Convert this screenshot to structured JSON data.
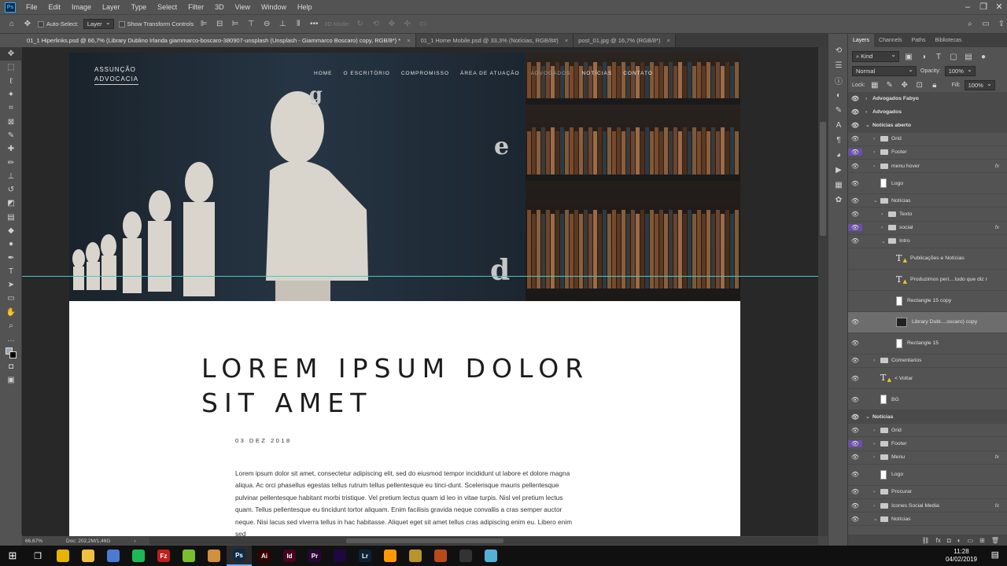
{
  "menu": {
    "items": [
      "File",
      "Edit",
      "Image",
      "Layer",
      "Type",
      "Select",
      "Filter",
      "3D",
      "View",
      "Window",
      "Help"
    ],
    "logo": "Ps"
  },
  "options": {
    "auto_select": "Auto-Select:",
    "layer_select": "Layer",
    "show_transform": "Show Transform Controls",
    "mode3d": "3D Mode:"
  },
  "tabs": [
    {
      "label": "01_1 Hiperlinks.psd @ 66,7% (Library Dublino Irlanda giammarco-boscaro-380907-unsplash (Unsplash - Giammarco Boscaro) copy, RGB/8*) *"
    },
    {
      "label": "01_1 Home Mobile.psd @ 33,3% (Notícias, RGB/8#)"
    },
    {
      "label": "post_01.jpg @ 16,7% (RGB/8*)"
    }
  ],
  "design": {
    "brand_line1": "ASSUNÇÃO",
    "brand_line2": "ADVOCACIA",
    "nav": [
      "HOME",
      "O ESCRITÓRIO",
      "COMPROMISSO",
      "ÁREA DE ATUAÇÃO",
      "ADVOGADOS",
      "NOTÍCIAS",
      "CONTATO"
    ],
    "hero_letters": [
      "g",
      "e",
      "d"
    ],
    "headline_1": "LOREM IPSUM DOLOR",
    "headline_2": "SIT AMET",
    "date": "03 DEZ 2018",
    "body": "Lorem ipsum dolor sit amet, consectetur adipiscing elit, sed do eiusmod tempor incididunt ut labore et dolore magna aliqua. Ac orci phasellus egestas tellus rutrum tellus pellentesque eu tinci-dunt. Scelerisque mauris pellentesque pulvinar pellentesque habitant morbi tristique. Vel pretium lectus quam id leo in vitae turpis. Nisl vel pretium lectus quam. Tellus pellentesque eu tincidunt tortor aliquam. Enim facilisis gravida neque convallis a cras semper auctor neque. Nisi lacus sed viverra tellus in hac habitasse. Aliquet eget sit amet tellus cras adipiscing enim eu. Libero enim sed"
  },
  "status": {
    "zoom": "66,67%",
    "doc": "Doc: 202,2M/1,46G"
  },
  "panel": {
    "tabs": [
      "Layers",
      "Channels",
      "Paths",
      "Bibliotecas"
    ],
    "kind": "Kind",
    "blend": "Normal",
    "opacity_label": "Opacity:",
    "opacity": "100%",
    "lock_label": "Lock:",
    "fill_label": "Fill:",
    "fill": "100%",
    "layers": [
      {
        "name": "Advogados Fabyo",
        "type": "group-head",
        "indent": 0
      },
      {
        "name": "Advogados",
        "type": "group-head",
        "indent": 0
      },
      {
        "name": "Notícias aberto",
        "type": "group-head-open",
        "indent": 0
      },
      {
        "name": "Grid",
        "type": "folder",
        "indent": 1
      },
      {
        "name": "Footer",
        "type": "folder",
        "indent": 1,
        "purple": true
      },
      {
        "name": "menu hover",
        "type": "folder",
        "indent": 1,
        "fx": true
      },
      {
        "name": "Logo",
        "type": "smart",
        "indent": 1
      },
      {
        "name": "Notícias",
        "type": "folder-open",
        "indent": 1
      },
      {
        "name": "Texto",
        "type": "folder",
        "indent": 2
      },
      {
        "name": "social",
        "type": "folder",
        "indent": 2,
        "purple": true,
        "fx": true
      },
      {
        "name": "Intro",
        "type": "folder-open",
        "indent": 2
      },
      {
        "name": "Publicações e Notícias",
        "type": "text",
        "indent": 3,
        "hidden": true
      },
      {
        "name": "Produzimos peri....tudo que diz r",
        "type": "text",
        "indent": 3,
        "hidden": true
      },
      {
        "name": "Rectangle 15 copy",
        "type": "shape",
        "indent": 3,
        "hidden": true
      },
      {
        "name": "Library Dubl....oscaro) copy",
        "type": "image",
        "indent": 3,
        "selected": true
      },
      {
        "name": "Rectangle 15",
        "type": "shape",
        "indent": 3
      },
      {
        "name": "Comentarios",
        "type": "folder",
        "indent": 1
      },
      {
        "name": "< Voltar",
        "type": "text",
        "indent": 1
      },
      {
        "name": "BG",
        "type": "shape",
        "indent": 1
      },
      {
        "name": "Notícias",
        "type": "group-head-open",
        "indent": 0
      },
      {
        "name": "Grid",
        "type": "folder",
        "indent": 1
      },
      {
        "name": "Footer",
        "type": "folder",
        "indent": 1,
        "purple": true
      },
      {
        "name": "Menu",
        "type": "folder",
        "indent": 1,
        "fx": true
      },
      {
        "name": "Logo",
        "type": "smart",
        "indent": 1
      },
      {
        "name": "Procurar",
        "type": "folder",
        "indent": 1
      },
      {
        "name": "Icones Social Media",
        "type": "folder",
        "indent": 1,
        "fx": true
      },
      {
        "name": "Notícias",
        "type": "folder-open",
        "indent": 1
      }
    ]
  },
  "taskbar": {
    "apps": [
      {
        "name": "chrome",
        "label": "",
        "color": "#e6b400"
      },
      {
        "name": "explorer",
        "label": "",
        "color": "#f0c040"
      },
      {
        "name": "app-circle",
        "label": "",
        "color": "#4a7bd0"
      },
      {
        "name": "spotify",
        "label": "",
        "color": "#1db954"
      },
      {
        "name": "filezilla",
        "label": "Fz",
        "color": "#bf1e1e"
      },
      {
        "name": "app-green",
        "label": "",
        "color": "#7bbd2f"
      },
      {
        "name": "app-game",
        "label": "",
        "color": "#d09040"
      },
      {
        "name": "photoshop",
        "label": "Ps",
        "color": "#0f2a47",
        "active": true
      },
      {
        "name": "illustrator",
        "label": "Ai",
        "color": "#330000"
      },
      {
        "name": "indesign",
        "label": "Id",
        "color": "#49021f"
      },
      {
        "name": "premiere",
        "label": "Pr",
        "color": "#2a0634"
      },
      {
        "name": "after-effects",
        "label": "",
        "color": "#1f0740"
      },
      {
        "name": "lightroom",
        "label": "Lr",
        "color": "#0c2236"
      },
      {
        "name": "sublime",
        "label": "",
        "color": "#ff9800"
      },
      {
        "name": "app-ring",
        "label": "",
        "color": "#b8952b"
      },
      {
        "name": "app-web",
        "label": "",
        "color": "#b84a1a"
      },
      {
        "name": "app-square",
        "label": "",
        "color": "#333"
      },
      {
        "name": "app-folder",
        "label": "",
        "color": "#55b0d8"
      }
    ],
    "time": "11:28",
    "date": "04/02/2019"
  }
}
